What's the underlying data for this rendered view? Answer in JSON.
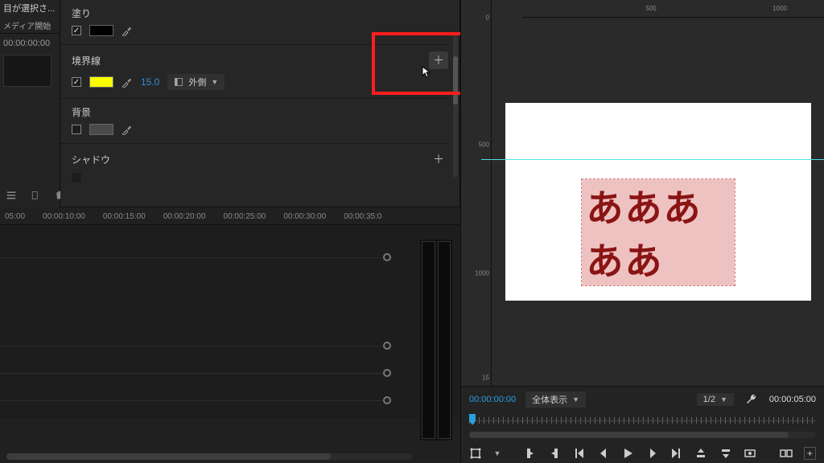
{
  "project": {
    "trunc_item": "目が選択さ...",
    "col_header": "メディア開始",
    "cell_tc": "00:00:00:00"
  },
  "fx": {
    "fill": {
      "title": "塗り",
      "swatch": "#000000"
    },
    "stroke": {
      "title": "境界線",
      "swatch": "#faff00",
      "value": "15.0",
      "position": "外側"
    },
    "bg": {
      "title": "背景",
      "swatch": "#4a4a4a"
    },
    "shadow": {
      "title": "シャドウ"
    }
  },
  "timeline": {
    "ticks": [
      "05:00",
      "00:00:10:00",
      "00:00:15:00",
      "00:00:20:00",
      "00:00:25:00",
      "00:00:30:00",
      "00:00:35:0"
    ]
  },
  "monitor": {
    "v_ticks": [
      "0",
      "500",
      "1000",
      "15"
    ],
    "h_ticks": [
      "500",
      "1000"
    ],
    "sample_text": "あああああ",
    "tc_current": "00:00:00:00",
    "fit_label": "全体表示",
    "res_label": "1/2",
    "tc_out": "00:00:05:00"
  }
}
